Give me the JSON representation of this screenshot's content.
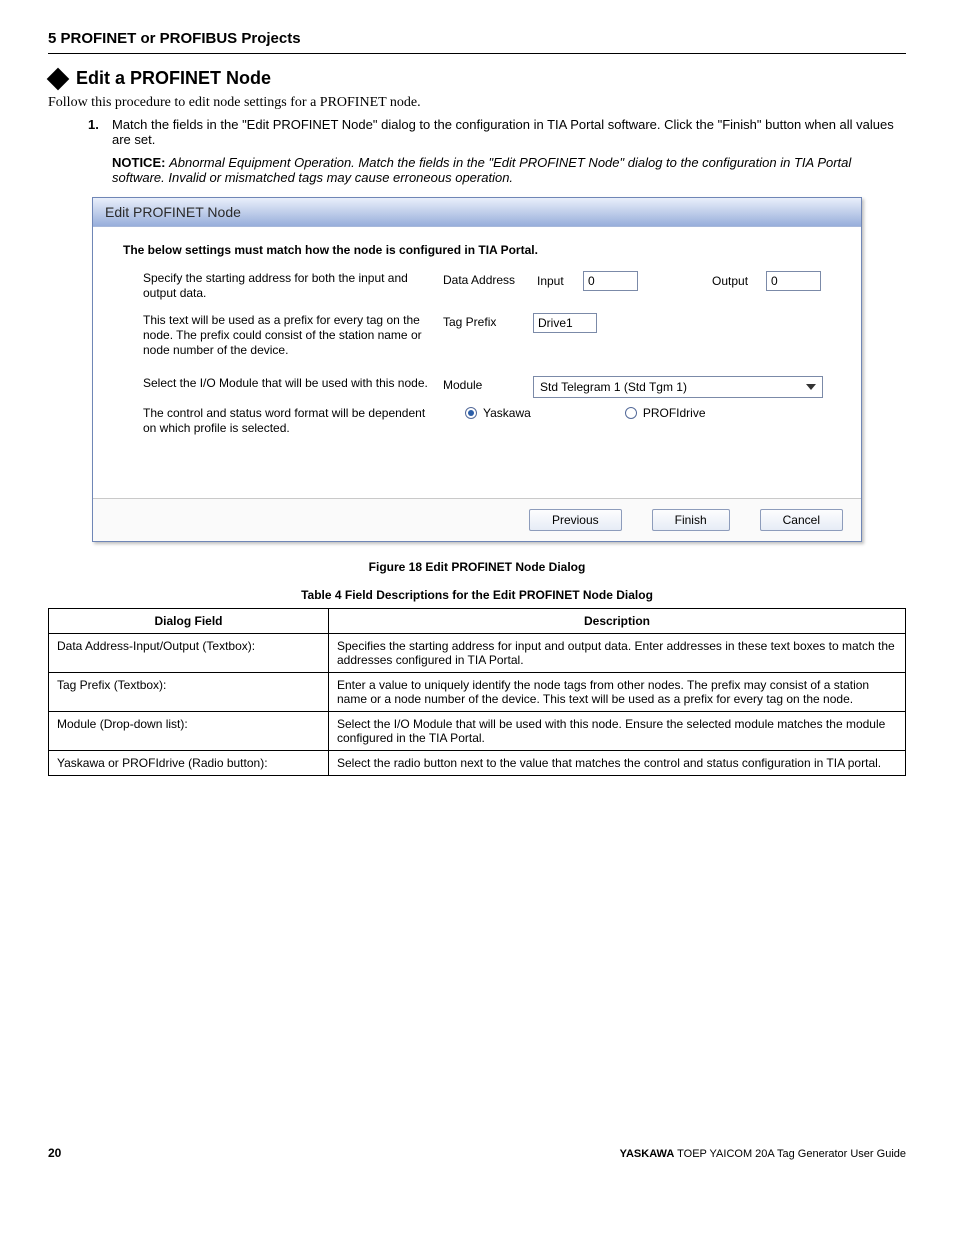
{
  "header": "5 PROFINET or PROFIBUS Projects",
  "section_title": "Edit a PROFINET Node",
  "intro": "Follow this procedure to edit node settings for a PROFINET node.",
  "step_num": "1.",
  "step_text": "Match the fields in the \"Edit PROFINET Node\" dialog to the configuration in TIA Portal software. Click the \"Finish\" button when all values are set.",
  "notice_label": "NOTICE:",
  "notice_body": "Abnormal Equipment Operation. Match the fields in the \"Edit PROFINET Node\" dialog to the configuration in TIA Portal software. Invalid or mismatched tags may cause erroneous operation.",
  "dialog": {
    "title": "Edit PROFINET Node",
    "instruction": "The below settings must match how the node is configured in TIA Portal.",
    "row1_desc": "Specify the starting address for both the input and output data.",
    "row1_label": "Data Address",
    "row1_input_label": "Input",
    "row1_input_val": "0",
    "row1_output_label": "Output",
    "row1_output_val": "0",
    "row2_desc": "This text will be used as a prefix for every tag on the node.  The prefix could consist of the station name or node number of the device.",
    "row2_label": "Tag Prefix",
    "row2_val": "Drive1",
    "row3_desc": "Select the I/O Module that will be used with this node.",
    "row3_label": "Module",
    "row3_val": "Std Telegram 1 (Std Tgm 1)",
    "row4_desc": "The control and status word format will be dependent on which profile is selected.",
    "radio1": "Yaskawa",
    "radio2": "PROFIdrive",
    "btn_prev": "Previous",
    "btn_finish": "Finish",
    "btn_cancel": "Cancel"
  },
  "fig_caption": "Figure 18  Edit PROFINET Node Dialog",
  "tbl_caption": "Table 4  Field Descriptions for the Edit PROFINET Node Dialog",
  "table": {
    "h1": "Dialog Field",
    "h2": "Description",
    "rows": [
      {
        "f": "Data Address-Input/Output (Textbox):",
        "d": "Specifies the starting address for input and output data. Enter addresses in these text boxes to match the addresses configured in TIA Portal."
      },
      {
        "f": "Tag Prefix (Textbox):",
        "d": "Enter a value to uniquely identify the node tags from other nodes. The prefix may consist of a station name or a node number of the device. This text will be used as a prefix for every tag on the node."
      },
      {
        "f": "Module (Drop-down list):",
        "d": "Select the I/O Module that will be used with this node. Ensure the selected module matches the module configured in the TIA Portal."
      },
      {
        "f": "Yaskawa or PROFIdrive (Radio button):",
        "d": "Select the radio button next to the value that matches the control and status configuration in TIA portal."
      }
    ]
  },
  "footer": {
    "page": "20",
    "brand": "YASKAWA",
    "doc": " TOEP YAICOM 20A Tag Generator User Guide"
  }
}
